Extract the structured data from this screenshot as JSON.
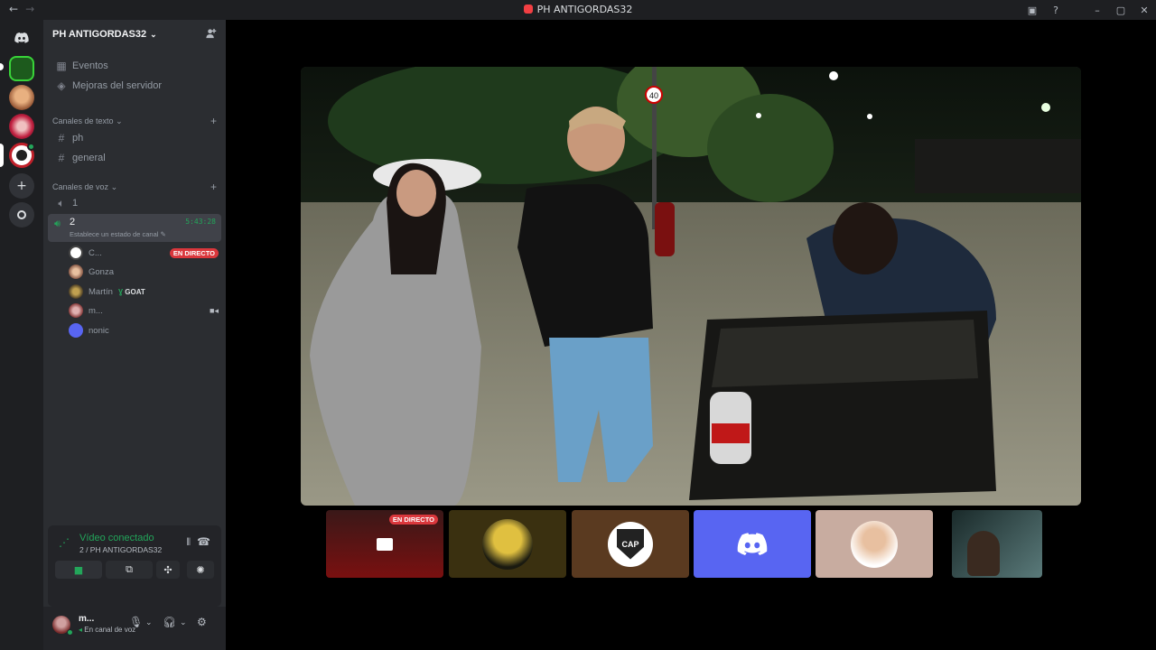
{
  "window": {
    "title": "PH ANTIGORDAS32",
    "back_icon": "arrow-left-icon",
    "forward_icon": "arrow-right-icon"
  },
  "server": {
    "name": "PH ANTIGORDAS32",
    "menu": {
      "events": "Eventos",
      "boosts": "Mejoras del servidor"
    },
    "text_category": "Canales de texto",
    "text_channels": [
      "ph",
      "general"
    ],
    "voice_category": "Canales de voz",
    "voice_channels": {
      "first": "1",
      "active": {
        "name": "2",
        "timer": "5:43:28",
        "status_placeholder": "Establece un estado de canal"
      }
    },
    "members": [
      {
        "name": "C...",
        "badge": "EN DIRECTO"
      },
      {
        "name": "Gonza"
      },
      {
        "name": "Martín",
        "tag": "GOAT"
      },
      {
        "name": "m..."
      },
      {
        "name": "nonic"
      }
    ]
  },
  "voice_panel": {
    "title": "Vídeo conectado",
    "subtitle": "2 / PH ANTIGORDAS32"
  },
  "user": {
    "name": "m...",
    "status": "En canal de voz"
  },
  "stream": {
    "live_label": "EN DIRECTO",
    "sign_text": "40"
  },
  "tiles": {
    "cap_text": "CAP"
  },
  "colors": {
    "accent": "#5865f2",
    "live": "#da373c",
    "connected": "#23a55a"
  }
}
